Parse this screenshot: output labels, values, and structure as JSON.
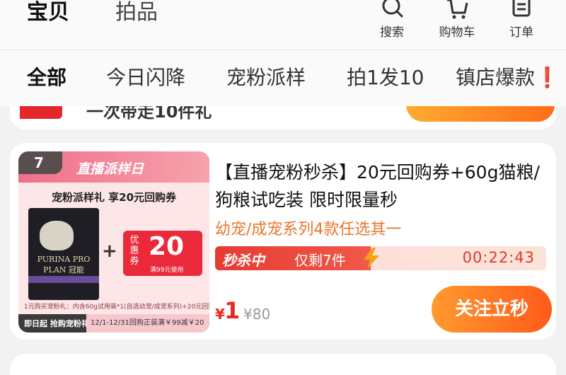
{
  "top_tabs": [
    {
      "label": "宝贝",
      "active": true
    },
    {
      "label": "拍品",
      "active": false
    }
  ],
  "nav_buttons": [
    {
      "label": "搜索",
      "icon": "search-icon"
    },
    {
      "label": "购物车",
      "icon": "cart-icon"
    },
    {
      "label": "订单",
      "icon": "order-list-icon"
    }
  ],
  "categories": [
    "全部",
    "今日闪降",
    "宠粉派样",
    "拍1发10",
    "镇店爆款"
  ],
  "categories_active": "全部",
  "category_suffix": "❗",
  "prev_card": {
    "text": "一次带走10件礼"
  },
  "product": {
    "rank": "7",
    "thumb_banner": "直播派样日",
    "thumb_subtitle": "宠粉派样礼 享20元回购券",
    "thumb_brand": "PURINA PRO PLAN 冠能",
    "thumb_voucher_label": "优惠券",
    "thumb_voucher_value": "20",
    "thumb_voucher_sub": "满99元使用",
    "thumb_note": "1元购买宠粉礼：内含60g试用装*1(自选幼宠/成宠系列)+20元回购券",
    "thumb_footer_left": "即日起 抢购宠粉礼",
    "thumb_footer_right": "12/1-12/31回购正装满￥99减￥20",
    "title": "【直播宠粉秒杀】20元回购券+60g猫粮/狗粮试吃装 限时限量秒",
    "tag": "幼宠/成宠系列4款任选其一",
    "flash_tag": "秒杀中",
    "flash_remaining": "仅剩7件",
    "countdown": "00:22:43",
    "currency": "¥",
    "price": "1",
    "original_price": "¥80",
    "buy_button": "关注立秒"
  },
  "colors": {
    "accent_orange": "#ff6c1a",
    "price_red": "#ea2a1f",
    "tag_orange": "#e9752a",
    "flash_red": "#e63b32"
  }
}
